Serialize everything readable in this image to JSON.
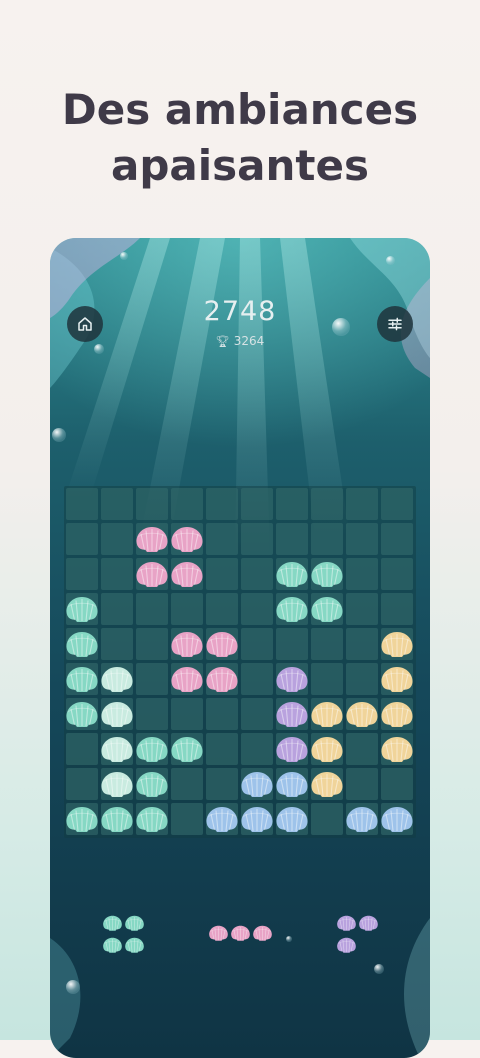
{
  "headline": {
    "line1": "Des ambiances",
    "line2": "apaisantes"
  },
  "game": {
    "score": "2748",
    "best_score": "3264",
    "icons": {
      "home": "home-icon",
      "settings": "settings-sliders-icon",
      "best": "trophy-icon"
    }
  },
  "colors": {
    "pink": "#e8a3c6",
    "teal": "#86d8c4",
    "mint": "#c9ebe0",
    "lavender": "#b9a2de",
    "yellow": "#f0d49a",
    "blue": "#9ec3ea"
  },
  "board": {
    "rows": 10,
    "cols": 10,
    "cells": [
      "..........",
      "..pp......",
      "..pp..tt..",
      "t.....tt..",
      "t..pp....y",
      "tm.pp.l..y",
      "tm....lyyy",
      ".mtt..ly.y",
      ".mt..bby..",
      "ttt.bbb.bb"
    ]
  },
  "tray": [
    {
      "color": "teal",
      "cells": [
        [
          0,
          0
        ],
        [
          0,
          1
        ],
        [
          1,
          0
        ],
        [
          1,
          1
        ]
      ]
    },
    {
      "color": "pink",
      "cells": [
        [
          0,
          0
        ],
        [
          0,
          1
        ],
        [
          0,
          2
        ]
      ]
    },
    {
      "color": "lavender",
      "cells": [
        [
          0,
          0
        ],
        [
          0,
          1
        ],
        [
          1,
          0
        ]
      ]
    }
  ]
}
